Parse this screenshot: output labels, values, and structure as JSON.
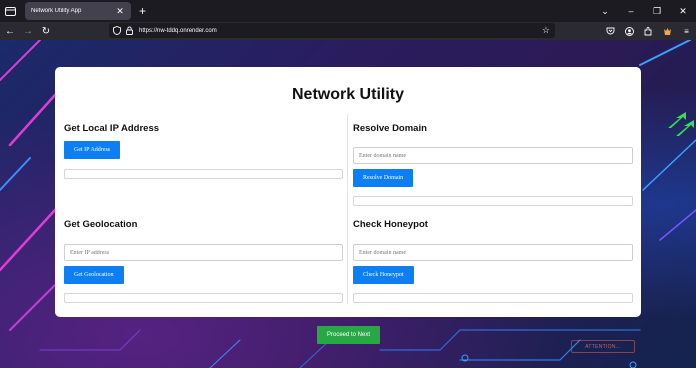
{
  "browser": {
    "tab_title": "Network Utility App",
    "url": "https://nw-tddq.onrender.com"
  },
  "page": {
    "title": "Network Utility",
    "sections": {
      "local_ip": {
        "heading": "Get Local IP Address",
        "button_label": "Get IP Address"
      },
      "resolve_domain": {
        "heading": "Resolve Domain",
        "input_placeholder": "Enter domain name",
        "button_label": "Resolve Domain"
      },
      "geolocation": {
        "heading": "Get Geolocation",
        "input_placeholder": "Enter IP address",
        "button_label": "Get Geolocation"
      },
      "honeypot": {
        "heading": "Check Honeypot",
        "input_placeholder": "Enter domain name",
        "button_label": "Check Honeypot"
      }
    },
    "proceed_label": "Proceed to Next",
    "background_badge": "ATTENTION..."
  },
  "colors": {
    "primary_button": "#0d7ff2",
    "proceed_button": "#28a745",
    "browser_chrome": "#1c1b22",
    "toolbar": "#2b2a33"
  },
  "icons": [
    "tab-list-icon",
    "close-icon",
    "plus-icon",
    "chevron-down-icon",
    "minimize-icon",
    "restore-icon",
    "window-close-icon",
    "back-arrow-icon",
    "forward-arrow-icon",
    "reload-icon",
    "shield-icon",
    "lock-icon",
    "star-icon",
    "pocket-icon",
    "account-icon",
    "extensions-icon",
    "extension-fox-icon",
    "menu-icon"
  ]
}
